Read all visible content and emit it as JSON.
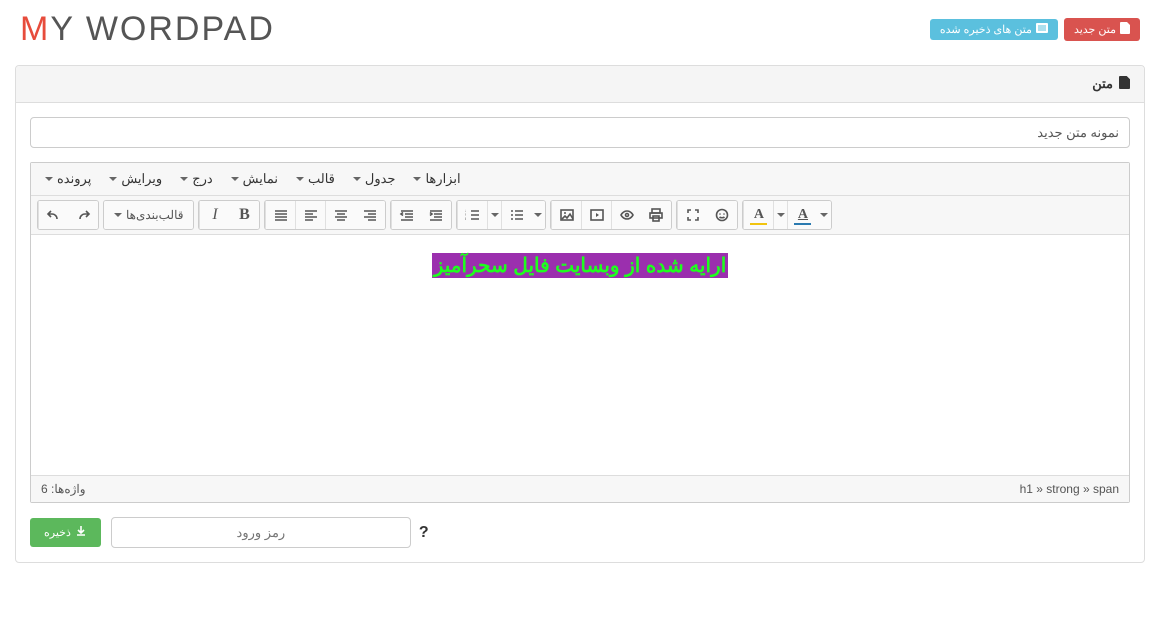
{
  "topbar": {
    "new_text": "متن جدید",
    "saved_texts": "متن های ذخیره شده",
    "logo_prefix": "M",
    "logo_rest": "Y WORDPAD"
  },
  "panel": {
    "header": "متن",
    "title_value": "نمونه متن جدید"
  },
  "menubar": {
    "file": "پرونده",
    "edit": "ویرایش",
    "insert": "درج",
    "view": "نمایش",
    "format": "قالب",
    "table": "جدول",
    "tools": "ابزارها"
  },
  "toolbar": {
    "formats_label": "قالب‌بندی‌ها"
  },
  "editor": {
    "content": "ارایه شده از وبسایت فایل سحرآمیز"
  },
  "statusbar": {
    "path": "h1 » strong » span",
    "words": "واژه‌ها: 6"
  },
  "footer": {
    "save": "ذخیره",
    "password_placeholder": "رمز ورود",
    "help": "?"
  }
}
